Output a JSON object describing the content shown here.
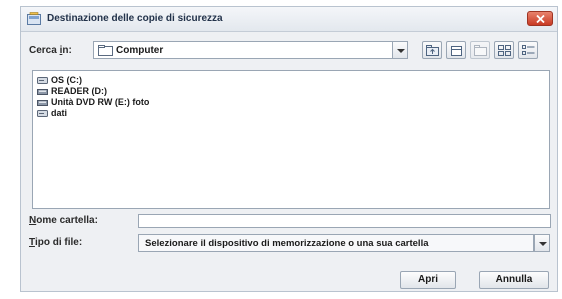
{
  "dialog": {
    "title": "Destinazione delle copie di sicurezza"
  },
  "lookin": {
    "label_prefix": "Cerca ",
    "label_accel": "i",
    "label_suffix": "n:",
    "value": "Computer"
  },
  "toolbar": {
    "icons": [
      "up-folder-icon",
      "home-icon",
      "new-folder-icon",
      "list-view-icon",
      "details-view-icon"
    ]
  },
  "files": {
    "items": [
      {
        "label": "OS (C:)",
        "icon": "hard-drive-icon"
      },
      {
        "label": "READER (D:)",
        "icon": "drive-icon"
      },
      {
        "label": "Unità DVD RW (E:) foto",
        "icon": "dvd-drive-icon"
      },
      {
        "label": "dati",
        "icon": "hard-drive-icon"
      }
    ]
  },
  "folder_name": {
    "label_accel": "N",
    "label_rest": "ome cartella:",
    "value": ""
  },
  "file_type": {
    "label_accel": "T",
    "label_rest": "ipo di file:",
    "value": "Selezionare il dispositivo di memorizzazione o una sua cartella"
  },
  "buttons": {
    "open": "Apri",
    "cancel": "Annulla"
  },
  "colors": {
    "close_button": "#c83a24",
    "window_bg": "#eef0f3"
  }
}
